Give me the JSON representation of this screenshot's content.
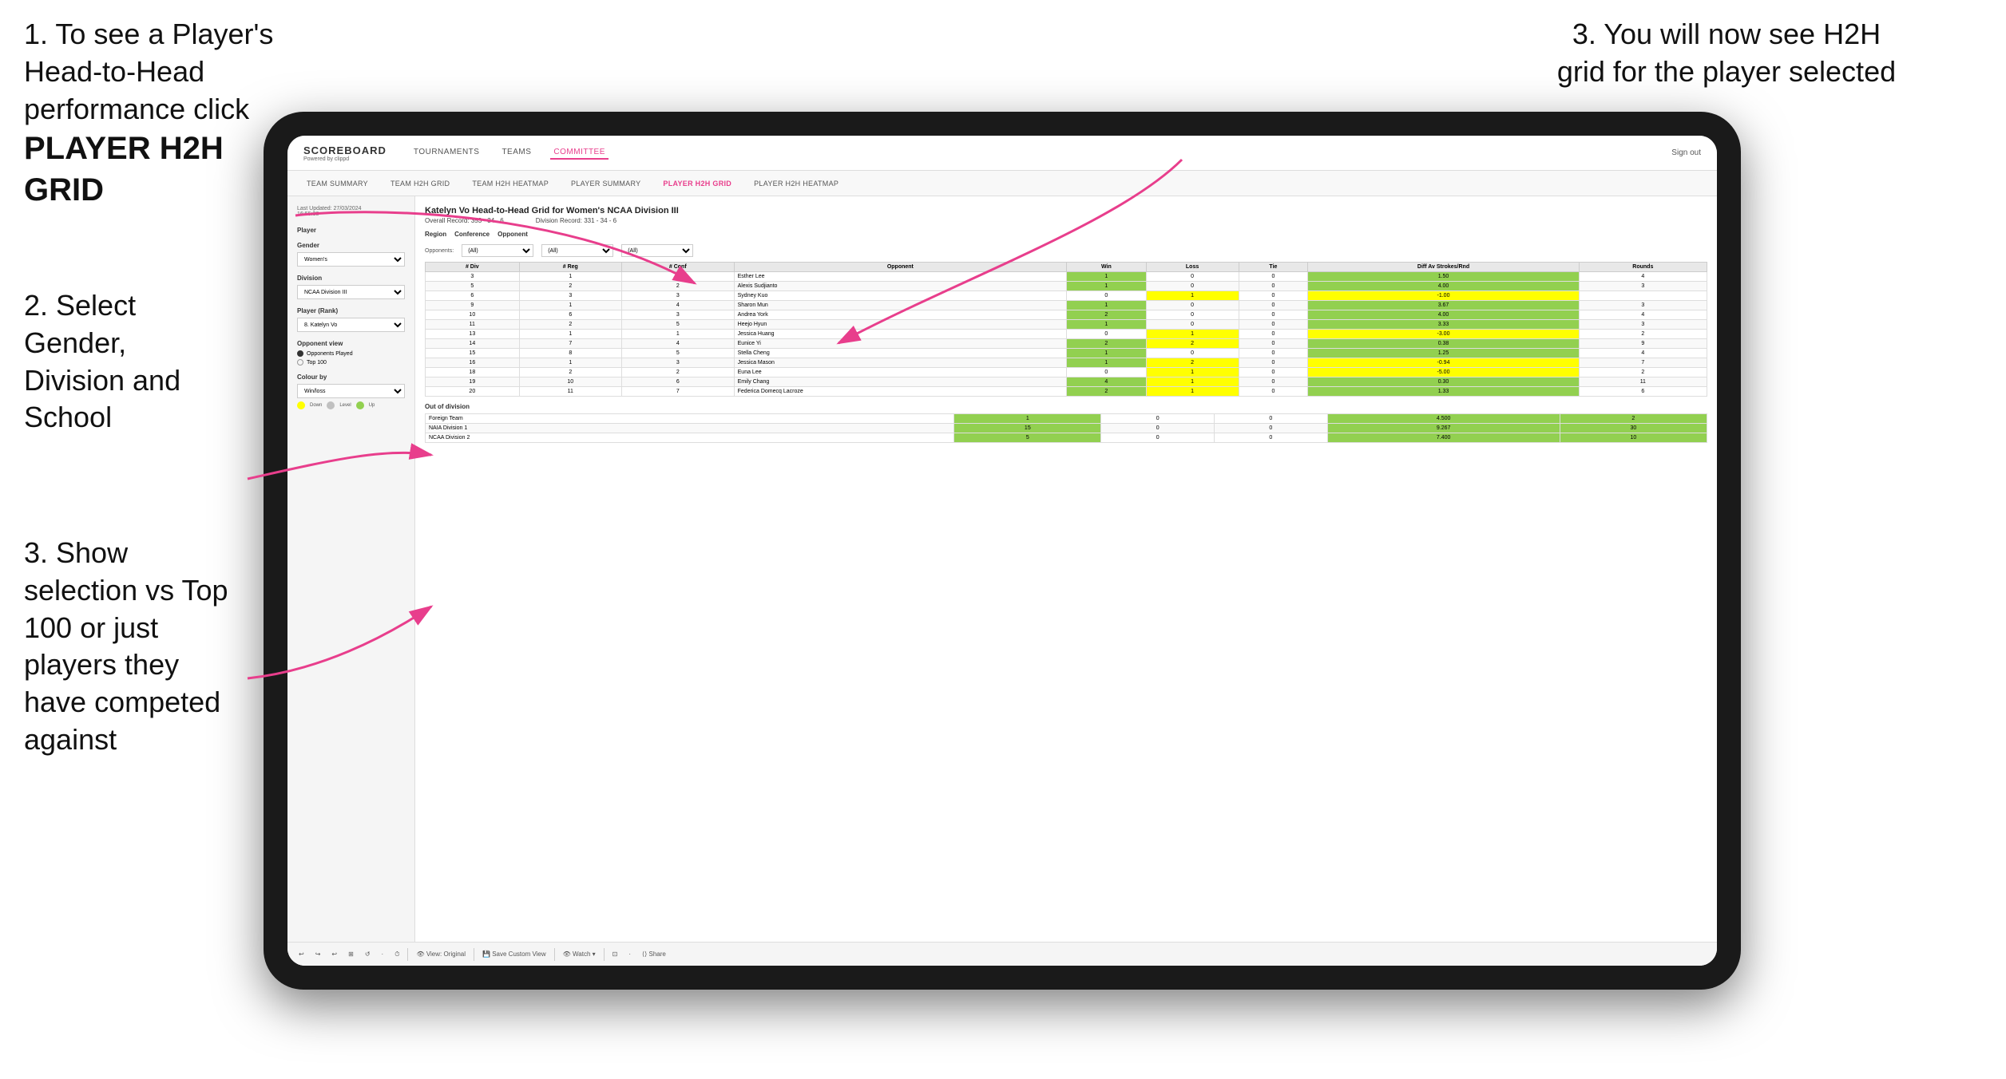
{
  "instructions": {
    "step1_title": "1. To see a Player's Head-to-Head performance click",
    "step1_bold": "PLAYER H2H GRID",
    "step2": "2. Select Gender, Division and School",
    "step3_top": "3. You will now see H2H grid for the player selected",
    "step3_bottom": "3. Show selection vs Top 100 or just players they have competed against"
  },
  "nav": {
    "logo": "SCOREBOARD",
    "logo_sub": "Powered by clippd",
    "items": [
      "TOURNAMENTS",
      "TEAMS",
      "COMMITTEE"
    ],
    "active": "COMMITTEE",
    "sign_out": "Sign out"
  },
  "sub_nav": {
    "items": [
      "TEAM SUMMARY",
      "TEAM H2H GRID",
      "TEAM H2H HEATMAP",
      "PLAYER SUMMARY",
      "PLAYER H2H GRID",
      "PLAYER H2H HEATMAP"
    ],
    "active": "PLAYER H2H GRID"
  },
  "left_panel": {
    "last_updated": "Last Updated: 27/03/2024",
    "last_updated_time": "16:55:38",
    "player_label": "Player",
    "gender_label": "Gender",
    "gender_value": "Women's",
    "division_label": "Division",
    "division_value": "NCAA Division III",
    "player_rank_label": "Player (Rank)",
    "player_rank_value": "8. Katelyn Vo",
    "opponent_view_label": "Opponent view",
    "radio1": "Opponents Played",
    "radio2": "Top 100",
    "colour_label": "Colour by",
    "colour_value": "Win/loss",
    "colour_down": "Down",
    "colour_level": "Level",
    "colour_up": "Up"
  },
  "grid": {
    "title": "Katelyn Vo Head-to-Head Grid for Women's NCAA Division III",
    "overall_record_label": "Overall Record:",
    "overall_record": "353 - 34 - 6",
    "division_record_label": "Division Record:",
    "division_record": "331 - 34 - 6",
    "region_label": "Region",
    "conference_label": "Conference",
    "opponent_label": "Opponent",
    "opponents_label": "Opponents:",
    "region_filter": "(All)",
    "conference_filter": "(All)",
    "opponent_filter": "(All)",
    "col_div": "# Div",
    "col_reg": "# Reg",
    "col_conf": "# Conf",
    "col_opponent": "Opponent",
    "col_win": "Win",
    "col_loss": "Loss",
    "col_tie": "Tie",
    "col_diff": "Diff Av Strokes/Rnd",
    "col_rounds": "Rounds",
    "rows": [
      {
        "div": 3,
        "reg": 1,
        "conf": 1,
        "opponent": "Esther Lee",
        "win": 1,
        "loss": 0,
        "tie": 0,
        "diff": "1.50",
        "rounds": 4,
        "diff_color": "green"
      },
      {
        "div": 5,
        "reg": 2,
        "conf": 2,
        "opponent": "Alexis Sudjianto",
        "win": 1,
        "loss": 0,
        "tie": 0,
        "diff": "4.00",
        "rounds": 3,
        "diff_color": "green"
      },
      {
        "div": 6,
        "reg": 3,
        "conf": 3,
        "opponent": "Sydney Kuo",
        "win": 0,
        "loss": 1,
        "tie": 0,
        "diff": "-1.00",
        "rounds": "",
        "diff_color": "yellow"
      },
      {
        "div": 9,
        "reg": 1,
        "conf": 4,
        "opponent": "Sharon Mun",
        "win": 1,
        "loss": 0,
        "tie": 0,
        "diff": "3.67",
        "rounds": 3,
        "diff_color": "green"
      },
      {
        "div": 10,
        "reg": 6,
        "conf": 3,
        "opponent": "Andrea York",
        "win": 2,
        "loss": 0,
        "tie": 0,
        "diff": "4.00",
        "rounds": 4,
        "diff_color": "green"
      },
      {
        "div": 11,
        "reg": 2,
        "conf": 5,
        "opponent": "Heejo Hyun",
        "win": 1,
        "loss": 0,
        "tie": 0,
        "diff": "3.33",
        "rounds": 3,
        "diff_color": "green"
      },
      {
        "div": 13,
        "reg": 1,
        "conf": 1,
        "opponent": "Jessica Huang",
        "win": 0,
        "loss": 1,
        "tie": 0,
        "diff": "-3.00",
        "rounds": 2,
        "diff_color": "yellow"
      },
      {
        "div": 14,
        "reg": 7,
        "conf": 4,
        "opponent": "Eunice Yi",
        "win": 2,
        "loss": 2,
        "tie": 0,
        "diff": "0.38",
        "rounds": 9,
        "diff_color": "green"
      },
      {
        "div": 15,
        "reg": 8,
        "conf": 5,
        "opponent": "Stella Cheng",
        "win": 1,
        "loss": 0,
        "tie": 0,
        "diff": "1.25",
        "rounds": 4,
        "diff_color": "green"
      },
      {
        "div": 16,
        "reg": 1,
        "conf": 3,
        "opponent": "Jessica Mason",
        "win": 1,
        "loss": 2,
        "tie": 0,
        "diff": "-0.94",
        "rounds": 7,
        "diff_color": "yellow"
      },
      {
        "div": 18,
        "reg": 2,
        "conf": 2,
        "opponent": "Euna Lee",
        "win": 0,
        "loss": 1,
        "tie": 0,
        "diff": "-5.00",
        "rounds": 2,
        "diff_color": "yellow"
      },
      {
        "div": 19,
        "reg": 10,
        "conf": 6,
        "opponent": "Emily Chang",
        "win": 4,
        "loss": 1,
        "tie": 0,
        "diff": "0.30",
        "rounds": 11,
        "diff_color": "green"
      },
      {
        "div": 20,
        "reg": 11,
        "conf": 7,
        "opponent": "Federica Domecq Lacroze",
        "win": 2,
        "loss": 1,
        "tie": 0,
        "diff": "1.33",
        "rounds": 6,
        "diff_color": "green"
      }
    ],
    "out_of_division_label": "Out of division",
    "out_rows": [
      {
        "label": "Foreign Team",
        "win": 1,
        "loss": 0,
        "tie": 0,
        "diff": "4.500",
        "rounds": 2,
        "diff_color": "green"
      },
      {
        "label": "NAIA Division 1",
        "win": 15,
        "loss": 0,
        "tie": 0,
        "diff": "9.267",
        "rounds": 30,
        "diff_color": "green"
      },
      {
        "label": "NCAA Division 2",
        "win": 5,
        "loss": 0,
        "tie": 0,
        "diff": "7.400",
        "rounds": 10,
        "diff_color": "green"
      }
    ]
  },
  "toolbar": {
    "items": [
      "↩",
      "↪",
      "↩",
      "⊞",
      "↺",
      "·",
      "⏱",
      "|",
      "👁 View: Original",
      "|",
      "💾 Save Custom View",
      "|",
      "👁 Watch ▾",
      "|",
      "⊡",
      "·",
      "⟨⟩ Share"
    ]
  }
}
